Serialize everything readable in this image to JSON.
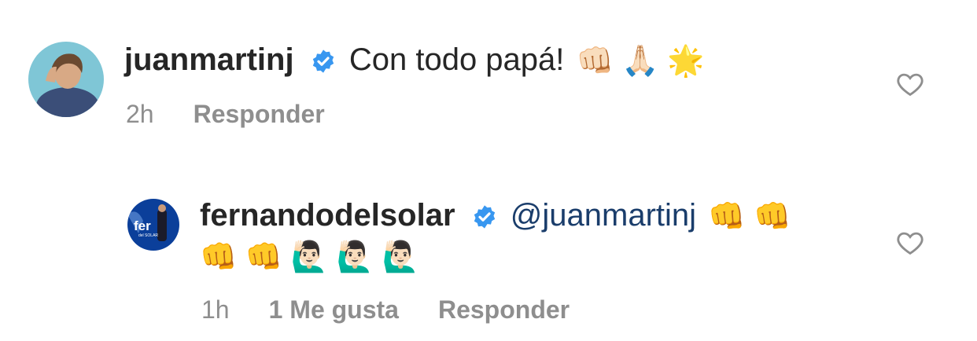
{
  "comments": [
    {
      "username": "juanmartinj",
      "text": "Con todo papá!",
      "emoji": "👊🏻 🙏🏻 🌟",
      "time": "2h",
      "reply_label": "Responder"
    },
    {
      "username": "fernandodelsolar",
      "mention": "@juanmartinj",
      "emoji_line1": "👊 👊",
      "emoji_line2": "👊 👊 🙋🏻‍♂️ 🙋🏻‍♂️ 🙋🏻‍♂️",
      "avatar_text": "fer",
      "avatar_subtext": "del SOLAR",
      "time": "1h",
      "likes_label": "1 Me gusta",
      "reply_label": "Responder"
    }
  ],
  "colors": {
    "verified": "#3897f0",
    "meta_gray": "#8e8e8e",
    "mention": "#1a3d6b"
  }
}
